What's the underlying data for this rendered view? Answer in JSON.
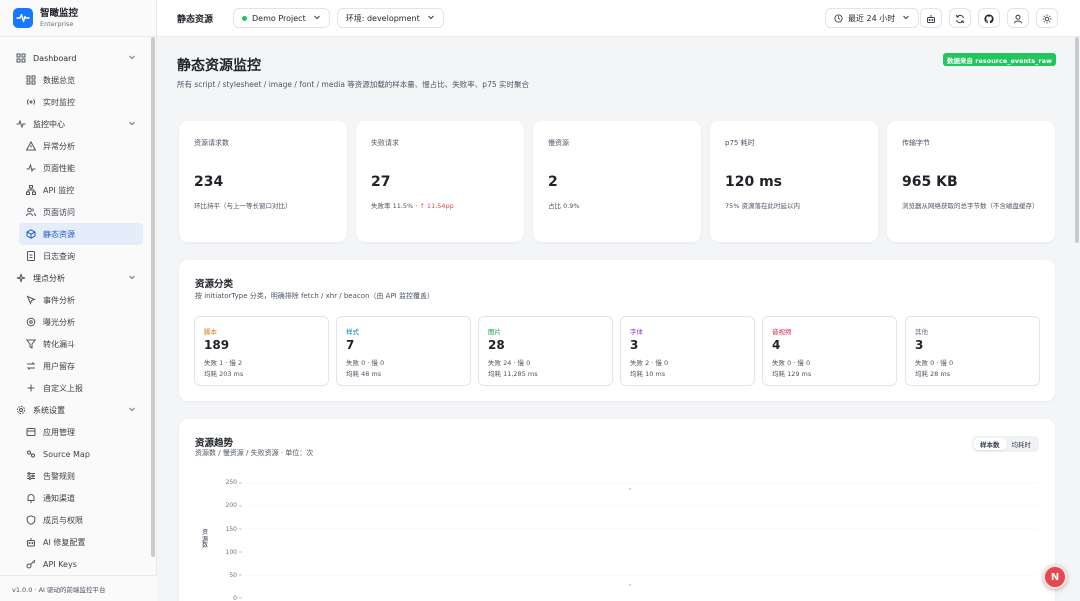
{
  "brand": {
    "name": "智瞰监控",
    "subtitle": "Enterprise"
  },
  "sidebar": {
    "groups": [
      {
        "label": "Dashboard",
        "icon": "grid-icon",
        "items": [
          {
            "label": "数据总览",
            "icon": "grid-icon"
          },
          {
            "label": "实时监控",
            "icon": "radio-icon"
          }
        ]
      },
      {
        "label": "监控中心",
        "icon": "activity-icon",
        "items": [
          {
            "label": "异常分析",
            "icon": "alert-icon"
          },
          {
            "label": "页面性能",
            "icon": "pulse-icon"
          },
          {
            "label": "API 监控",
            "icon": "network-icon"
          },
          {
            "label": "页面访问",
            "icon": "users-icon"
          },
          {
            "label": "静态资源",
            "icon": "cube-icon",
            "active": true
          },
          {
            "label": "日志查询",
            "icon": "file-icon"
          }
        ]
      },
      {
        "label": "埋点分析",
        "icon": "sparkle-icon",
        "items": [
          {
            "label": "事件分析",
            "icon": "pointer-icon"
          },
          {
            "label": "曝光分析",
            "icon": "target-icon"
          },
          {
            "label": "转化漏斗",
            "icon": "funnel-icon"
          },
          {
            "label": "用户留存",
            "icon": "swap-icon"
          },
          {
            "label": "自定义上报",
            "icon": "plus-icon"
          }
        ]
      },
      {
        "label": "系统设置",
        "icon": "gear-icon",
        "items": [
          {
            "label": "应用管理",
            "icon": "folder-icon"
          },
          {
            "label": "Source Map",
            "icon": "map-icon"
          },
          {
            "label": "告警规则",
            "icon": "sliders-icon"
          },
          {
            "label": "通知渠道",
            "icon": "bell-icon"
          },
          {
            "label": "成员与权限",
            "icon": "shield-icon"
          },
          {
            "label": "AI 修复配置",
            "icon": "bot-icon"
          },
          {
            "label": "API Keys",
            "icon": "key-icon"
          }
        ]
      }
    ],
    "version": "v1.0.0 · AI 驱动的前端监控平台"
  },
  "topbar": {
    "title": "静态资源",
    "project": "Demo Project",
    "env": "环境: development",
    "range": "最近 24 小时"
  },
  "page": {
    "title": "静态资源监控",
    "description": "所有 script / stylesheet / image / font / media 等资源加载的样本量、慢占比、失败率、p75 实时聚合",
    "source_badge": "数据来自 resource_events_raw"
  },
  "kpis": [
    {
      "label": "资源请求数",
      "value": "234",
      "sub": "环比持平（与上一等长窗口对比）"
    },
    {
      "label": "失败请求",
      "value": "27",
      "sub": "失败率 11.5% · ",
      "trend": "↑ 11.54pp"
    },
    {
      "label": "慢资源",
      "value": "2",
      "sub": "占比 0.9%"
    },
    {
      "label": "p75 耗时",
      "value": "120 ms",
      "sub": "75% 资源落在此时延以内"
    },
    {
      "label": "传输字节",
      "value": "965 KB",
      "sub": "浏览器从网络获取的总字节数（不含磁盘缓存）"
    }
  ],
  "categories": {
    "title": "资源分类",
    "subtitle": "按 initiatorType 分类，明确排除 fetch / xhr / beacon（由 API 监控覆盖）",
    "items": [
      {
        "name": "脚本",
        "color": "#d97706",
        "count": "189",
        "line1": "失败 1 · 慢 2",
        "line2": "均耗 203 ms"
      },
      {
        "name": "样式",
        "color": "#0284c7",
        "count": "7",
        "line1": "失败 0 · 慢 0",
        "line2": "均耗 48 ms"
      },
      {
        "name": "图片",
        "color": "#16a34a",
        "count": "28",
        "line1": "失败 24 · 慢 0",
        "line2": "均耗 11,285 ms"
      },
      {
        "name": "字体",
        "color": "#9333ea",
        "count": "3",
        "line1": "失败 2 · 慢 0",
        "line2": "均耗 10 ms"
      },
      {
        "name": "音视频",
        "color": "#e11d48",
        "count": "4",
        "line1": "失败 0 · 慢 0",
        "line2": "均耗 129 ms"
      },
      {
        "name": "其他",
        "color": "#6b7280",
        "count": "3",
        "line1": "失败 0 · 慢 0",
        "line2": "均耗 28 ms"
      }
    ]
  },
  "trend": {
    "title": "资源趋势",
    "subtitle": "资源数 / 慢资源 / 失败资源 · 单位：次",
    "tab_samples": "样本数",
    "tab_avg": "均耗时",
    "y_label": "资源数",
    "y_ticks": [
      "250",
      "200",
      "150",
      "100",
      "50",
      "0"
    ]
  },
  "fab": {
    "label": "N"
  },
  "chart_data": {
    "type": "line",
    "title": "资源趋势",
    "ylabel": "资源数",
    "ylim": [
      0,
      250
    ],
    "yticks": [
      0,
      50,
      100,
      150,
      200,
      250
    ],
    "grid": true,
    "series": []
  }
}
